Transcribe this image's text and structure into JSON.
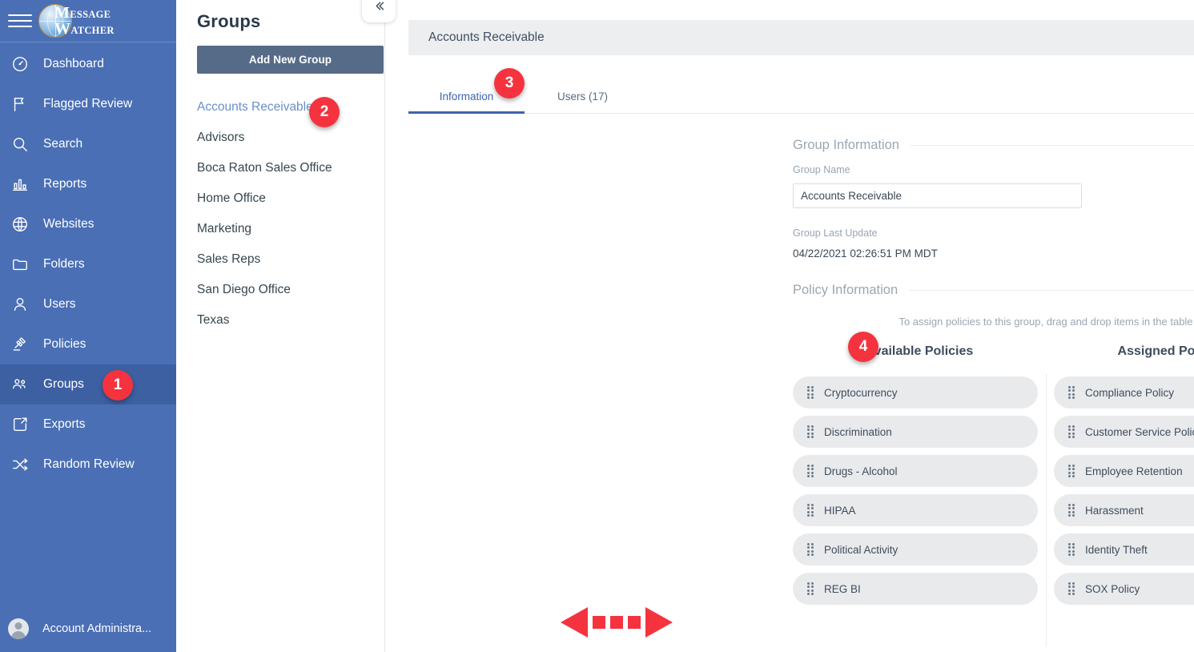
{
  "brand": {
    "line1_cap": "M",
    "line1_rest": "ESSAGE",
    "line2_cap": "W",
    "line2_rest": "ATCHER",
    "logo_icon": "globe-compass-icon",
    "menu_icon": "hamburger-menu-icon"
  },
  "sidebar": {
    "items": [
      {
        "label": "Dashboard",
        "icon": "speedometer-icon",
        "active": false
      },
      {
        "label": "Flagged Review",
        "icon": "flag-icon",
        "active": false
      },
      {
        "label": "Search",
        "icon": "search-icon",
        "active": false
      },
      {
        "label": "Reports",
        "icon": "bar-chart-icon",
        "active": false
      },
      {
        "label": "Websites",
        "icon": "globe-icon",
        "active": false
      },
      {
        "label": "Folders",
        "icon": "folder-icon",
        "active": false
      },
      {
        "label": "Users",
        "icon": "user-icon",
        "active": false
      },
      {
        "label": "Policies",
        "icon": "gavel-icon",
        "active": false
      },
      {
        "label": "Groups",
        "icon": "people-group-icon",
        "active": true
      },
      {
        "label": "Exports",
        "icon": "external-link-icon",
        "active": false
      },
      {
        "label": "Random Review",
        "icon": "shuffle-icon",
        "active": false
      }
    ],
    "footer": {
      "label": "Account Administra...",
      "icon": "avatar-icon"
    }
  },
  "groups_panel": {
    "title": "Groups",
    "add_button": "Add New Group",
    "collapse_icon": "chevron-double-left-icon",
    "items": [
      {
        "label": "Accounts Receivable",
        "selected": true
      },
      {
        "label": "Advisors",
        "selected": false
      },
      {
        "label": "Boca Raton Sales Office",
        "selected": false
      },
      {
        "label": "Home Office",
        "selected": false
      },
      {
        "label": "Marketing",
        "selected": false
      },
      {
        "label": "Sales Reps",
        "selected": false
      },
      {
        "label": "San Diego Office",
        "selected": false
      },
      {
        "label": "Texas",
        "selected": false
      }
    ]
  },
  "main": {
    "header_title": "Accounts Receivable",
    "tabs": [
      {
        "label": "Information",
        "active": true
      },
      {
        "label": "Users (17)",
        "active": false
      }
    ],
    "group_information": {
      "section_title": "Group Information",
      "group_name_label": "Group Name",
      "group_name_value": "Accounts Receivable",
      "group_name_placeholder": "Group Name",
      "last_update_label": "Group Last Update",
      "last_update_value": "04/22/2021 02:26:51 PM MDT"
    },
    "policy_information": {
      "section_title": "Policy Information",
      "hint": "To assign policies to this group, drag and drop items in the table",
      "available_header": "Available Policies",
      "assigned_header": "Assigned Policies",
      "available": [
        "Cryptocurrency",
        "Discrimination",
        "Drugs - Alcohol",
        "HIPAA",
        "Political Activity",
        "REG BI"
      ],
      "assigned": [
        "Compliance Policy",
        "Customer Service Policy",
        "Employee Retention",
        "Harassment",
        "Identity Theft",
        "SOX Policy"
      ],
      "drag_arrow_icon": "dashed-double-arrow-icon"
    }
  },
  "annotations": {
    "badges": [
      {
        "number": "1",
        "target": "sidebar-item-groups"
      },
      {
        "number": "2",
        "target": "group-item-accounts-receivable"
      },
      {
        "number": "3",
        "target": "tab-information"
      },
      {
        "number": "4",
        "target": "assigned-policies-header"
      }
    ]
  },
  "colors": {
    "sidebar_bg": "#4a6fb5",
    "sidebar_active": "#3d60a3",
    "accent_blue": "#3f62b0",
    "badge_red": "#f5333f",
    "button_slate": "#566b88",
    "pill_gray": "#e9eaec",
    "header_gray": "#eceef0"
  }
}
